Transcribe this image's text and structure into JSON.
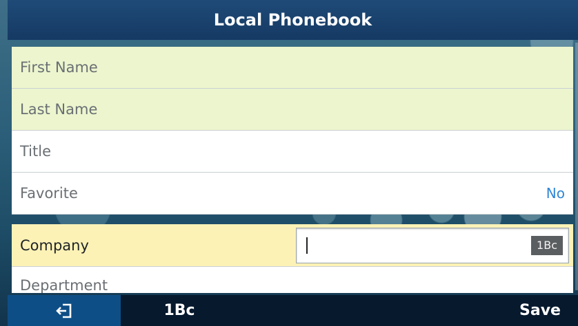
{
  "header": {
    "title": "Local Phonebook"
  },
  "fields": [
    {
      "label": "First Name",
      "value": ""
    },
    {
      "label": "Last Name",
      "value": ""
    },
    {
      "label": "Title",
      "value": ""
    },
    {
      "label": "Favorite",
      "value": "No"
    }
  ],
  "active_field": {
    "label": "Company",
    "value": "",
    "input_mode": "1Bc"
  },
  "next_field": {
    "label": "Department"
  },
  "softkeys": {
    "back": "back-icon",
    "mode": "1Bc",
    "save": "Save"
  },
  "colors": {
    "title_bar": "#1b4270",
    "filled_row": "#ecf5ce",
    "active_row": "#fdf2b6",
    "value_text": "#2f86d6",
    "softkey_active": "#0e4e86"
  }
}
